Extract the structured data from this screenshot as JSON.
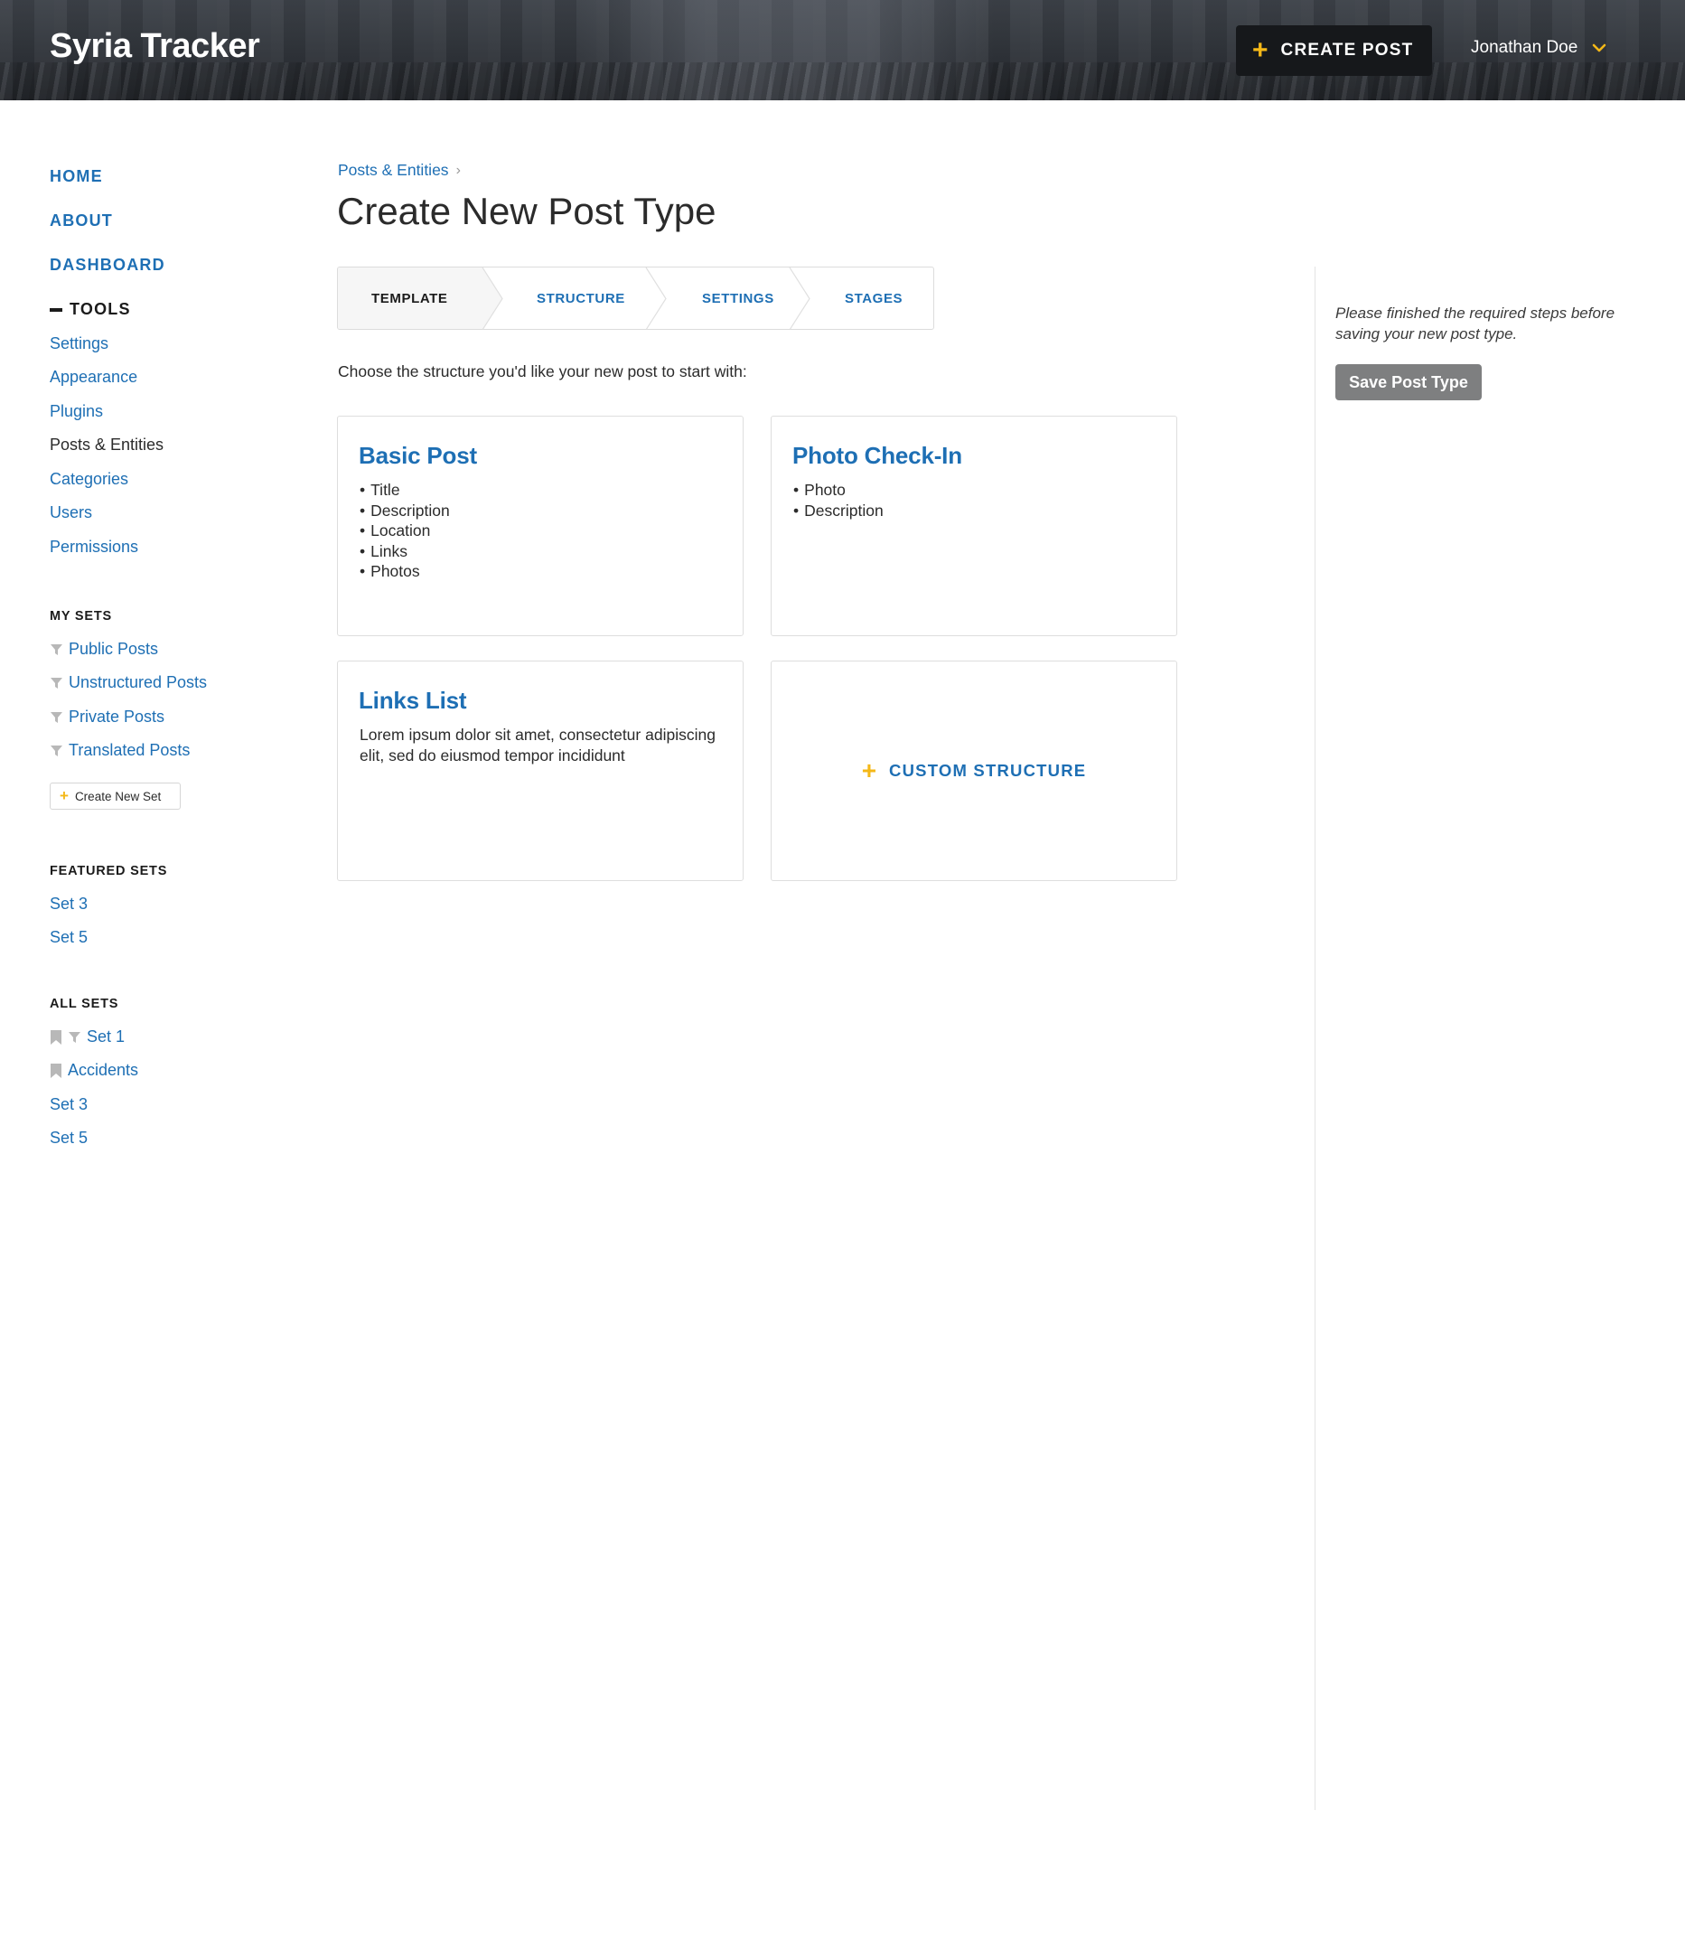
{
  "header": {
    "app_title": "Syria Tracker",
    "create_post_label": "CREATE POST",
    "user_name": "Jonathan Doe"
  },
  "sidebar": {
    "main_nav": [
      {
        "label": "HOME"
      },
      {
        "label": "ABOUT"
      },
      {
        "label": "DASHBOARD"
      },
      {
        "label": "TOOLS"
      }
    ],
    "tools_items": [
      {
        "label": "Settings"
      },
      {
        "label": "Appearance"
      },
      {
        "label": "Plugins"
      },
      {
        "label": "Posts & Entities",
        "active": true
      },
      {
        "label": "Categories"
      },
      {
        "label": "Users"
      },
      {
        "label": "Permissions"
      }
    ],
    "my_sets": {
      "heading": "MY SETS",
      "items": [
        {
          "label": "Public Posts",
          "icon": "filter-icon"
        },
        {
          "label": "Unstructured Posts",
          "icon": "filter-icon"
        },
        {
          "label": "Private Posts",
          "icon": "filter-icon"
        },
        {
          "label": "Translated Posts",
          "icon": "filter-icon"
        }
      ],
      "create_label": "Create New Set"
    },
    "featured_sets": {
      "heading": "FEATURED SETS",
      "items": [
        {
          "label": "Set 3"
        },
        {
          "label": "Set 5"
        }
      ]
    },
    "all_sets": {
      "heading": "ALL SETS",
      "items": [
        {
          "label": "Set 1",
          "icons": [
            "bookmark-icon",
            "filter-icon"
          ]
        },
        {
          "label": "Accidents",
          "icons": [
            "bookmark-icon"
          ]
        },
        {
          "label": "Set 3"
        },
        {
          "label": "Set 5"
        }
      ]
    }
  },
  "main": {
    "breadcrumb": "Posts & Entities",
    "title": "Create New Post Type",
    "steps": [
      {
        "label": "TEMPLATE",
        "current": true
      },
      {
        "label": "STRUCTURE"
      },
      {
        "label": "SETTINGS"
      },
      {
        "label": "STAGES"
      }
    ],
    "instructions": "Choose the structure you'd like your new post to start with:",
    "cards": {
      "basic": {
        "title": "Basic Post",
        "items": [
          "Title",
          "Description",
          "Location",
          "Links",
          "Photos"
        ]
      },
      "photo": {
        "title": "Photo Check-In",
        "items": [
          "Photo",
          "Description"
        ]
      },
      "links": {
        "title": "Links List",
        "description": "Lorem ipsum dolor sit amet, consectetur adipiscing elit, sed do eiusmod tempor incididunt"
      },
      "custom": {
        "label": "CUSTOM STRUCTURE"
      }
    }
  },
  "right_panel": {
    "hint": "Please finished the required steps before saving your new post type.",
    "save_label": "Save Post Type"
  },
  "colors": {
    "link_blue": "#1e6fb4",
    "accent_yellow": "#f4b818",
    "header_dark": "#30343a",
    "button_dark": "#16181b",
    "save_gray": "#7e7f80"
  }
}
